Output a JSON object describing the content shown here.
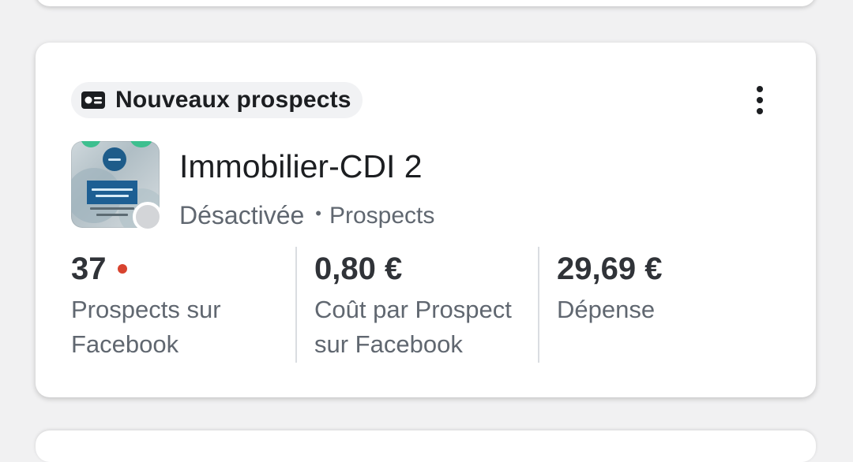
{
  "campaign_card": {
    "objective_chip": {
      "icon": "lead-form-icon",
      "label": "Nouveaux prospects"
    },
    "more_menu_icon": "more-vertical-icon",
    "campaign": {
      "name": "Immobilier-CDI 2",
      "status": "Désactivée",
      "separator": "•",
      "type": "Prospects",
      "status_color": "#d3d5d8"
    },
    "metrics": [
      {
        "value": "37",
        "label_line1": "Prospects sur",
        "label_line2": "Facebook",
        "alert_color": "#d8432f"
      },
      {
        "value": "0,80 €",
        "label_line1": "Coût par Prospect",
        "label_line2": "sur Facebook"
      },
      {
        "value": "29,69 €",
        "label_line1": "Dépense",
        "label_line2": ""
      }
    ]
  }
}
